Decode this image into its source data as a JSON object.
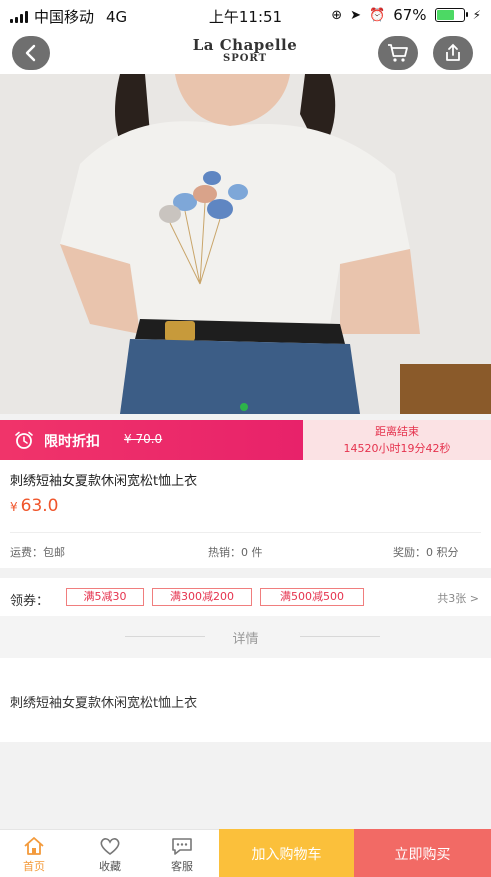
{
  "status": {
    "carrier": "中国移动",
    "network": "4G",
    "time": "上午11:51",
    "battery": "67%"
  },
  "header": {
    "brand_line1": "La Chapelle",
    "brand_line2": "SPORT"
  },
  "promo": {
    "label": "限时折扣",
    "old_price": "¥ 70.0",
    "countdown_label": "距离结束",
    "countdown": "14520小时19分42秒"
  },
  "product": {
    "title": "刺绣短袖女夏款休闲宽松t恤上衣",
    "price_symbol": "¥",
    "price": "63.0",
    "shipping": "运费：包邮",
    "sales": "热销：0 件",
    "reward": "奖励：0 积分"
  },
  "coupons": {
    "label": "领券：",
    "items": [
      "满5减30",
      "满300减200",
      "满500减500"
    ],
    "count": "共3张 >"
  },
  "detail": {
    "heading": "详情",
    "description": "刺绣短袖女夏款休闲宽松t恤上衣"
  },
  "bottombar": {
    "home": "首页",
    "favorite": "收藏",
    "service": "客服",
    "add_cart": "加入购物车",
    "buy_now": "立即购买"
  },
  "colors": {
    "accent_pink": "#e8226a",
    "price_orange": "#f0552b",
    "cart_yellow": "#fbc03b",
    "buy_red": "#f26a65",
    "home_active": "#f39a3b"
  }
}
